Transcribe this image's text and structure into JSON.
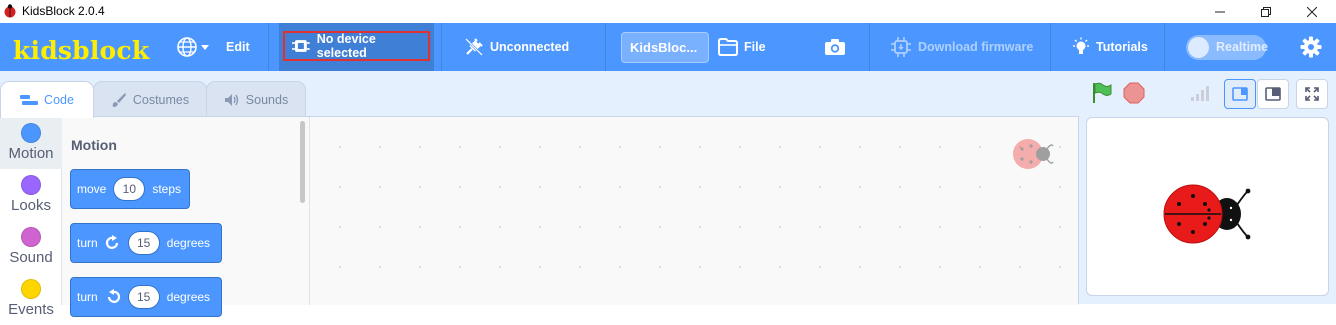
{
  "window": {
    "title": "KidsBlock 2.0.4",
    "minimize_icon": "minimize-icon",
    "maximize_icon": "restore-icon",
    "close_icon": "close-icon"
  },
  "menubar": {
    "logo": "kidsblock",
    "edit_label": "Edit",
    "device_label": "No device selected",
    "connection_label": "Unconnected",
    "project_title": "KidsBloc...",
    "file_label": "File",
    "download_label": "Download firmware",
    "tutorials_label": "Tutorials",
    "realtime_label": "Realtime",
    "colors": {
      "bar": "#4c97ff",
      "logo": "#ffee00",
      "highlight_border": "#e03030"
    }
  },
  "tabs": [
    {
      "label": "Code",
      "icon": "code-icon",
      "active": true
    },
    {
      "label": "Costumes",
      "icon": "brush-icon",
      "active": false
    },
    {
      "label": "Sounds",
      "icon": "speaker-icon",
      "active": false
    }
  ],
  "categories": [
    {
      "label": "Motion",
      "color": "#4c97ff"
    },
    {
      "label": "Looks",
      "color": "#9966ff"
    },
    {
      "label": "Sound",
      "color": "#cf63cf"
    },
    {
      "label": "Events",
      "color": "#ffd500"
    }
  ],
  "palette": {
    "title": "Motion",
    "blocks": [
      {
        "pre": "move",
        "value": "10",
        "post": "steps",
        "icon": ""
      },
      {
        "pre": "turn",
        "value": "15",
        "post": "degrees",
        "icon": "rotate-right-icon"
      },
      {
        "pre": "turn",
        "value": "15",
        "post": "degrees",
        "icon": "rotate-left-icon"
      }
    ]
  },
  "stage_controls": {
    "green_flag_icon": "green-flag-icon",
    "stop_icon": "stop-icon",
    "signal_icon": "signal-bars-icon"
  }
}
